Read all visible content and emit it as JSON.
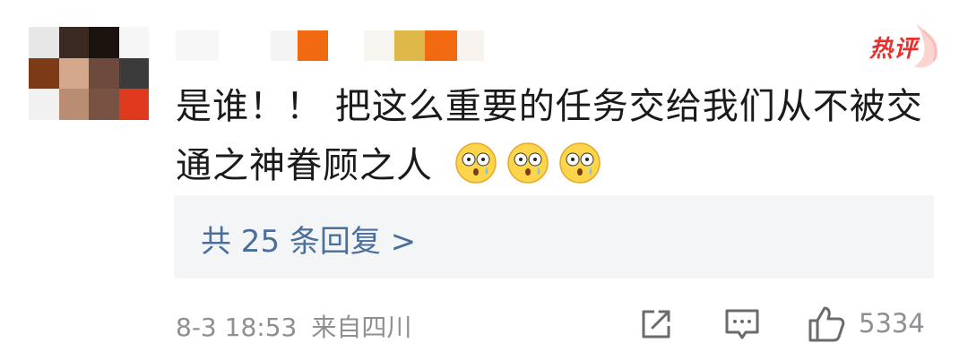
{
  "comment": {
    "text": "是谁！！ 把这么重要的任务交给我们从不被交通之神眷顾之人",
    "emojis": [
      "flushed-face-icon",
      "flushed-face-icon",
      "flushed-face-icon"
    ],
    "badge": "热评"
  },
  "replies": {
    "label": "共 25 条回复 >"
  },
  "footer": {
    "time": "8-3 18:53",
    "location": "来自四川",
    "like_count": "5334"
  },
  "colors": {
    "badge_red": "#e8302e",
    "link_blue": "#4a6f9b",
    "meta_gray": "#8e8e93",
    "reply_bg": "#f4f5f7"
  }
}
